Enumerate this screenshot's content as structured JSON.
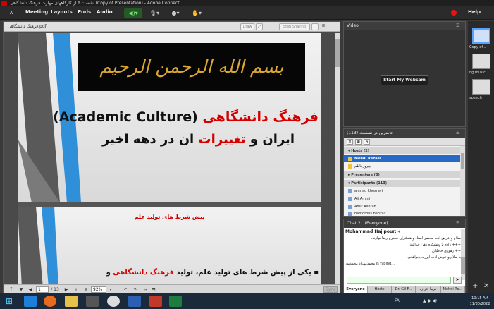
{
  "window": {
    "title": "نشست ۵ از کارگاههای مهارت فرهنگ دانشگاهی (Copy of Presentation) - Adobe Connect"
  },
  "menu": {
    "items": [
      "Meeting",
      "Layouts",
      "Pods",
      "Audio"
    ],
    "help": "Help"
  },
  "share_pod": {
    "filename": "فرهنگ دانشگاهی.pdf",
    "buttons": {
      "draw": "Draw",
      "stop_sharing": "Stop Sharing"
    },
    "slide1": {
      "calligraphy": "بسم الله الرحمن الرحیم",
      "line1_red": "فرهنگ دانشگاهی",
      "line1_black": "(Academic Culture)",
      "line2_black_a": "ایران و",
      "line2_red": "تغییرات",
      "line2_black_b": "ان در دهه اخیر"
    },
    "slide2": {
      "title": "پیش شرط های تولید علم",
      "bullet_black": "یکی از پیش شرط های تولید علم، تولید",
      "bullet_red": "فرهنگ دانشگاهی",
      "bullet_tail": "و"
    },
    "footer": {
      "page_current": "1",
      "page_total": "/ 13",
      "zoom": "92%",
      "sync": "Sync"
    }
  },
  "video_pod": {
    "title": "Video",
    "webcam_button": "Start My Webcam"
  },
  "attendees_pod": {
    "title": "حاضرین در نشست  (113)",
    "hosts_header": "Hosts (2)",
    "hosts": [
      "Mehdi Rezaei",
      "بهروز ناظم"
    ],
    "presenters_header": "Presenters (0)",
    "participants_header": "Participants (113)",
    "participants": [
      "ahmad khosravi",
      "Ali Amini",
      "Amir Ashrafi",
      "bahforous behzaz"
    ]
  },
  "chat_pod": {
    "title": "Chat 2",
    "scope": "(Everyone)",
    "messages": [
      {
        "who": "Mohammad Hajipour:",
        "text": "+"
      },
      {
        "who": "",
        "text": "سلام و عرض ادب محضر استاد و همکاران محترم رضا نوازنده"
      },
      {
        "who": "",
        "text": "+++ زاده پژوهشکده زهرا خراشد"
      },
      {
        "who": "",
        "text": "++ زهوری خاطیان"
      },
      {
        "who": "",
        "text": "با سلام و عرض ادب ابرزیه بابراهانی"
      },
      {
        "who": "",
        "text": "محمدمهراد محمدپور is typing..."
      }
    ],
    "tabs": [
      "Everyone",
      "Hosts",
      "Dr. Gil F...",
      "فریبا افرازه",
      "Mehdi Re..."
    ]
  },
  "layouts": [
    {
      "label": "Copy of..."
    },
    {
      "label": "bg music"
    },
    {
      "label": "speech"
    }
  ],
  "taskbar": {
    "time": "10:15 AM",
    "date": "11/30/2022",
    "lang": "FA"
  }
}
